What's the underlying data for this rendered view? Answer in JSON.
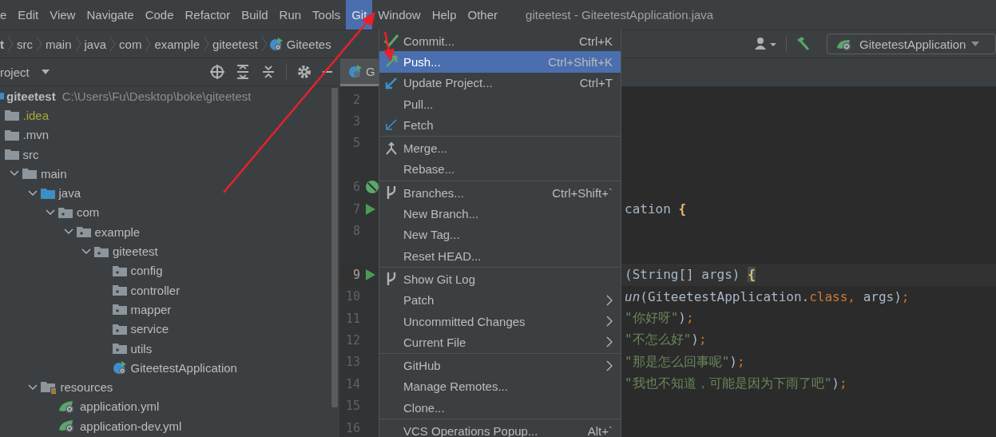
{
  "menu_bar": {
    "items": [
      {
        "label": "e",
        "selected": false
      },
      {
        "label": "Edit",
        "selected": false
      },
      {
        "label": "View",
        "selected": false
      },
      {
        "label": "Navigate",
        "selected": false
      },
      {
        "label": "Code",
        "selected": false
      },
      {
        "label": "Refactor",
        "selected": false
      },
      {
        "label": "Build",
        "selected": false
      },
      {
        "label": "Run",
        "selected": false
      },
      {
        "label": "Tools",
        "selected": false
      },
      {
        "label": "Git",
        "selected": true
      },
      {
        "label": "Window",
        "selected": false
      },
      {
        "label": "Help",
        "selected": false
      },
      {
        "label": "Other",
        "selected": false
      }
    ],
    "title": "giteetest - GiteetestApplication.java"
  },
  "breadcrumbs": [
    "t",
    "src",
    "main",
    "java",
    "com",
    "example",
    "giteetest",
    "Giteetes"
  ],
  "run_config": {
    "label": "GiteetestApplication"
  },
  "project_panel": {
    "title": "roject",
    "tree": {
      "label": "giteetest",
      "path": "C:\\Users\\Fu\\Desktop\\boke\\giteetest",
      "children": [
        {
          "label": ".idea",
          "kind": "folder",
          "ignored": true
        },
        {
          "label": ".mvn",
          "kind": "folder",
          "ignored": false
        },
        {
          "label": "src",
          "kind": "folder",
          "ignored": false,
          "children": [
            {
              "label": "main",
              "kind": "folder",
              "ignored": false,
              "expanded": true,
              "children": [
                {
                  "label": "java",
                  "kind": "source-folder",
                  "ignored": false,
                  "expanded": true,
                  "children": [
                    {
                      "label": "com",
                      "kind": "package",
                      "ignored": false,
                      "expanded": true,
                      "children": [
                        {
                          "label": "example",
                          "kind": "package",
                          "ignored": false,
                          "expanded": true,
                          "children": [
                            {
                              "label": "giteetest",
                              "kind": "package",
                              "ignored": false,
                              "expanded": true,
                              "children": [
                                {
                                  "label": "config",
                                  "kind": "package",
                                  "ignored": false
                                },
                                {
                                  "label": "controller",
                                  "kind": "package",
                                  "ignored": false
                                },
                                {
                                  "label": "mapper",
                                  "kind": "package",
                                  "ignored": false
                                },
                                {
                                  "label": "service",
                                  "kind": "package",
                                  "ignored": false
                                },
                                {
                                  "label": "utils",
                                  "kind": "package",
                                  "ignored": false
                                },
                                {
                                  "label": "GiteetestApplication",
                                  "kind": "spring-class",
                                  "ignored": false
                                }
                              ]
                            }
                          ]
                        }
                      ]
                    }
                  ]
                },
                {
                  "label": "resources",
                  "kind": "resources-folder",
                  "ignored": false,
                  "expanded": true,
                  "children": [
                    {
                      "label": "application.yml",
                      "kind": "spring-config",
                      "ignored": false
                    },
                    {
                      "label": "application-dev.yml",
                      "kind": "spring-config",
                      "ignored": false
                    }
                  ]
                }
              ]
            }
          ]
        }
      ]
    }
  },
  "editor": {
    "tab": {
      "label": "G"
    },
    "lines": [
      {
        "kind": "line",
        "number": "2"
      },
      {
        "kind": "line",
        "number": "3"
      },
      {
        "kind": "line",
        "number": "5"
      },
      {
        "kind": "gap"
      },
      {
        "kind": "bean-line",
        "number": "6"
      },
      {
        "kind": "run-line",
        "number": "7",
        "tokens": [
          {
            "kind": "plain",
            "text": "cation "
          },
          {
            "kind": "brace",
            "text": "{"
          }
        ]
      },
      {
        "kind": "line",
        "number": "8"
      },
      {
        "kind": "gap"
      },
      {
        "kind": "run-line",
        "number": "9",
        "current": true,
        "tokens": [
          {
            "kind": "plain",
            "text": "(String[] args) "
          },
          {
            "kind": "brace-match",
            "text": "{"
          }
        ]
      },
      {
        "kind": "line",
        "number": "10",
        "tokens": [
          {
            "kind": "italic",
            "text": "un"
          },
          {
            "kind": "plain",
            "text": "(GiteetestApplication."
          },
          {
            "kind": "keyword",
            "text": "class, "
          },
          {
            "kind": "plain",
            "text": "args)"
          },
          {
            "kind": "keyword",
            "text": ";"
          }
        ]
      },
      {
        "kind": "line",
        "number": "11",
        "tokens": [
          {
            "kind": "string",
            "text": "\"你好呀\""
          },
          {
            "kind": "plain",
            "text": ")"
          },
          {
            "kind": "keyword",
            "text": ";"
          }
        ]
      },
      {
        "kind": "line",
        "number": "12",
        "tokens": [
          {
            "kind": "string",
            "text": "\"不怎么好\""
          },
          {
            "kind": "plain",
            "text": ")"
          },
          {
            "kind": "keyword",
            "text": ";"
          }
        ]
      },
      {
        "kind": "line",
        "number": "13",
        "tokens": [
          {
            "kind": "string",
            "text": "\"那是怎么回事呢\""
          },
          {
            "kind": "plain",
            "text": ")"
          },
          {
            "kind": "keyword",
            "text": ";"
          }
        ]
      },
      {
        "kind": "line",
        "number": "14",
        "tokens": [
          {
            "kind": "string",
            "text": "\"我也不知道，可能是因为下雨了吧\""
          },
          {
            "kind": "plain",
            "text": ")"
          },
          {
            "kind": "keyword",
            "text": ";"
          }
        ]
      },
      {
        "kind": "line",
        "number": "15"
      },
      {
        "kind": "line",
        "number": "16"
      }
    ]
  },
  "git_menu": {
    "groups": [
      [
        {
          "label": "Commit...",
          "shortcut": "Ctrl+K",
          "kind": "check",
          "selected": false
        },
        {
          "label": "Push...",
          "shortcut": "Ctrl+Shift+K",
          "kind": "push",
          "selected": true
        },
        {
          "label": "Update Project...",
          "shortcut": "Ctrl+T",
          "kind": "update",
          "selected": false
        },
        {
          "label": "Pull...",
          "selected": false
        },
        {
          "label": "Fetch",
          "kind": "fetch",
          "selected": false
        }
      ],
      [
        {
          "label": "Merge...",
          "kind": "merge",
          "selected": false
        },
        {
          "label": "Rebase...",
          "selected": false
        }
      ],
      [
        {
          "label": "Branches...",
          "shortcut": "Ctrl+Shift+`",
          "kind": "branch",
          "selected": false
        },
        {
          "label": "New Branch...",
          "selected": false
        },
        {
          "label": "New Tag...",
          "selected": false
        },
        {
          "label": "Reset HEAD...",
          "selected": false
        }
      ],
      [
        {
          "label": "Show Git Log",
          "kind": "branch",
          "selected": false
        },
        {
          "label": "Patch",
          "submenu": true,
          "selected": false
        },
        {
          "label": "Uncommitted Changes",
          "submenu": true,
          "selected": false
        },
        {
          "label": "Current File",
          "submenu": true,
          "selected": false
        }
      ],
      [
        {
          "label": "GitHub",
          "submenu": true,
          "selected": false
        },
        {
          "label": "Manage Remotes...",
          "selected": false
        },
        {
          "label": "Clone...",
          "selected": false
        }
      ],
      [
        {
          "label": "VCS Operations Popup...",
          "shortcut": "Alt+`",
          "selected": false
        }
      ]
    ]
  }
}
